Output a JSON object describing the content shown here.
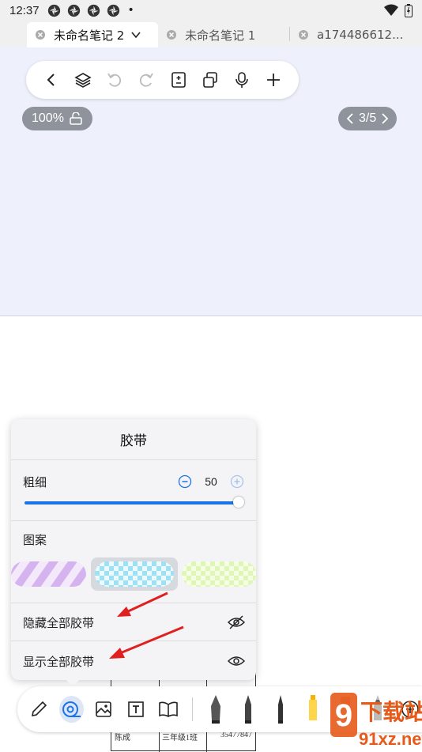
{
  "status_bar": {
    "time": "12:37",
    "dot": "•"
  },
  "tabs": [
    {
      "label": "未命名笔记 2",
      "active": true
    },
    {
      "label": "未命名笔记 1",
      "active": false
    },
    {
      "label": "a174486612...",
      "active": false
    }
  ],
  "toolbar": {
    "icons": [
      "back-icon",
      "layers-icon",
      "undo-icon",
      "redo-icon",
      "page-icon",
      "copy-icon",
      "mic-icon",
      "add-icon"
    ]
  },
  "canvas": {
    "zoom": "100%",
    "page_indicator": "3/5"
  },
  "tape_panel": {
    "title": "胶带",
    "thickness_label": "粗细",
    "thickness_value": "50",
    "pattern_label": "图案",
    "hide_all": "隐藏全部胶带",
    "show_all": "显示全部胶带",
    "patterns": [
      "purple-stripes",
      "blue-checker",
      "green-checker"
    ],
    "selected_pattern": "blue-checker"
  },
  "doc_table": {
    "cells": [
      "陈成",
      "三年级1班",
      "35477847"
    ]
  },
  "watermark": {
    "text": "下载站",
    "site": "91xz.net"
  },
  "colors": {
    "accent": "#1a73e8",
    "arrow": "#e02020"
  }
}
